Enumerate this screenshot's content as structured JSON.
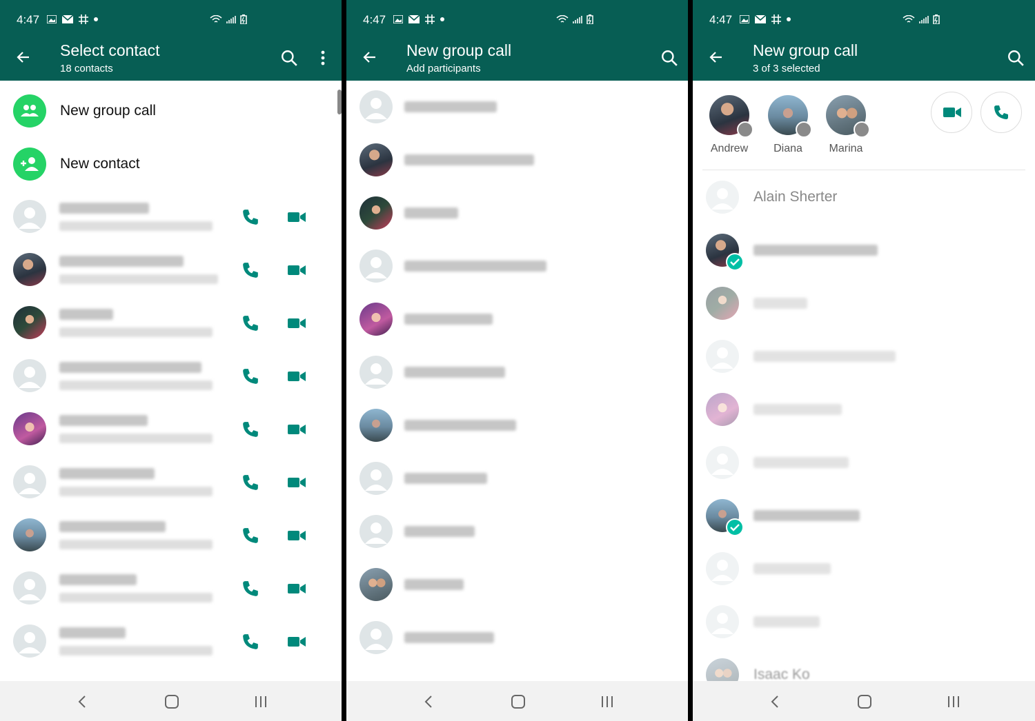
{
  "colors": {
    "header": "#075e54",
    "accent": "#25d366",
    "icon_teal": "#00897b",
    "check": "#00bfa5"
  },
  "status": {
    "time": "4:47"
  },
  "panel1": {
    "title": "Select contact",
    "subtitle": "18 contacts",
    "actions": [
      {
        "label": "New group call",
        "icon": "group-icon"
      },
      {
        "label": "New contact",
        "icon": "add-person-icon"
      }
    ]
  },
  "panel2": {
    "title": "New group call",
    "subtitle": "Add participants"
  },
  "panel3": {
    "title": "New group call",
    "subtitle": "3 of 3 selected",
    "selected": [
      {
        "name": "Andrew"
      },
      {
        "name": "Diana"
      },
      {
        "name": "Marina"
      }
    ],
    "first_contact": "Alain Sherter",
    "partial_contact": "Isaac Ko"
  },
  "icons": [
    "back-arrow-icon",
    "search-icon",
    "more-vert-icon",
    "phone-icon",
    "video-icon",
    "nav-back-icon",
    "nav-home-icon",
    "nav-recents-icon"
  ]
}
